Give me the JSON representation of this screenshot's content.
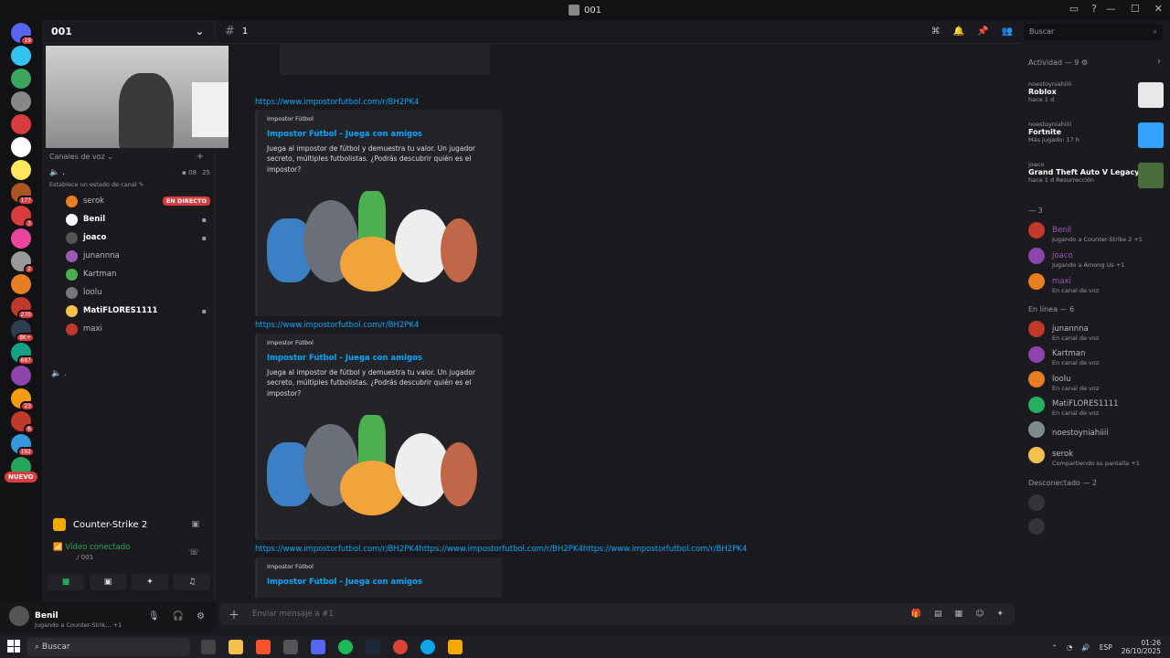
{
  "window": {
    "title": "001",
    "server_icon": "discord-server-icon"
  },
  "server": {
    "name": "001",
    "voice_category": "Canales de voz",
    "voice_channel": ".",
    "camera_count": "08",
    "user_count": "25",
    "status_hint": "Establece un estado de canal",
    "second_channel": "."
  },
  "voice_members": [
    {
      "name": "serok",
      "live": "EN DIRECTO",
      "bold": false,
      "color": "#b5bac1"
    },
    {
      "name": "Benil",
      "bold": true,
      "color": "#ffffff"
    },
    {
      "name": "joaco",
      "bold": true,
      "color": "#ffffff"
    },
    {
      "name": "junannna",
      "bold": false,
      "color": "#b5bac1"
    },
    {
      "name": "Kartman",
      "bold": false,
      "color": "#b5bac1"
    },
    {
      "name": "loolu",
      "bold": false,
      "color": "#b5bac1"
    },
    {
      "name": "MatiFLORES1111",
      "bold": true,
      "color": "#ffffff"
    },
    {
      "name": "maxi",
      "bold": false,
      "color": "#b5bac1"
    }
  ],
  "rail_badges": [
    "19",
    "",
    "",
    "",
    "",
    "",
    "",
    "177",
    "3",
    "",
    "2",
    "",
    "270",
    "8K+",
    "687",
    "",
    "23",
    "6",
    "192",
    ""
  ],
  "rail_new": "NUEVO",
  "game": {
    "name": "Counter-Strike 2"
  },
  "voice_status": {
    "label": "Vídeo conectado",
    "channel": "./ 001"
  },
  "user": {
    "name": "Benil",
    "status": "Jugando a Counter-Strik...",
    "extra": "+1"
  },
  "channel": {
    "name": "1"
  },
  "search": {
    "placeholder": "Buscar"
  },
  "messages": {
    "link1": "https://www.impostorfutbol.com/r/BH2PK4",
    "link2": "https://www.impostorfutbol.com/r/BH2PK4",
    "link3": "https://www.impostorfutbol.com/r/BH2PK4https://www.impostorfutbol.com/r/BH2PK4https://www.impostorfutbol.com/r/BH2PK4",
    "embed": {
      "provider": "Impostor Fútbol",
      "title": "Impostor Fútbol - Juega con amigos",
      "description": "Juega al impostor de fútbol y demuestra tu valor. Un jugador secreto, múltiples futbolistas. ¿Podrás descubrir quién es el impostor?"
    }
  },
  "input": {
    "placeholder": "Enviar mensaje a #1"
  },
  "activity": {
    "header": "Actividad — 9",
    "items": [
      {
        "who": "noestoyniahiiii",
        "game": "Roblox",
        "time": "hace 1 d",
        "color": "#e8e8e8"
      },
      {
        "who": "noestoyniahiiii",
        "game": "Fortnite",
        "time": "Más jugado: 17 h",
        "color": "#33a1ff"
      },
      {
        "who": "joaco",
        "game": "Grand Theft Auto V Legacy",
        "time": "hace 1 d  Resurrección",
        "color": "#4a6d3b"
      }
    ]
  },
  "groups": {
    "unnamed": "— 3",
    "online": "En línea — 6",
    "offline": "Desconectado — 2"
  },
  "group_members": [
    {
      "name": "Benil",
      "status": "Jugando a Counter-Strike 2 +1",
      "color": "#9b59b6"
    },
    {
      "name": "joaco",
      "status": "Jugando a Among Us +1",
      "color": "#9b59b6"
    },
    {
      "name": "maxi",
      "status": "En canal de voz",
      "color": "#9b59b6"
    }
  ],
  "online_members": [
    {
      "name": "junannna",
      "status": "En canal de voz",
      "color": "#b5bac1"
    },
    {
      "name": "Kartman",
      "status": "En canal de voz",
      "color": "#b5bac1"
    },
    {
      "name": "loolu",
      "status": "En canal de voz",
      "color": "#b5bac1"
    },
    {
      "name": "MatiFLORES1111",
      "status": "En canal de voz",
      "color": "#b5bac1"
    },
    {
      "name": "noestoyniahiiii",
      "status": "",
      "color": "#b5bac1"
    },
    {
      "name": "serok",
      "status": "Compartiendo su pantalla +1",
      "color": "#b5bac1"
    }
  ],
  "taskbar": {
    "search": "Buscar",
    "lang": "ESP",
    "time": "01:26",
    "date": "26/10/2025"
  }
}
